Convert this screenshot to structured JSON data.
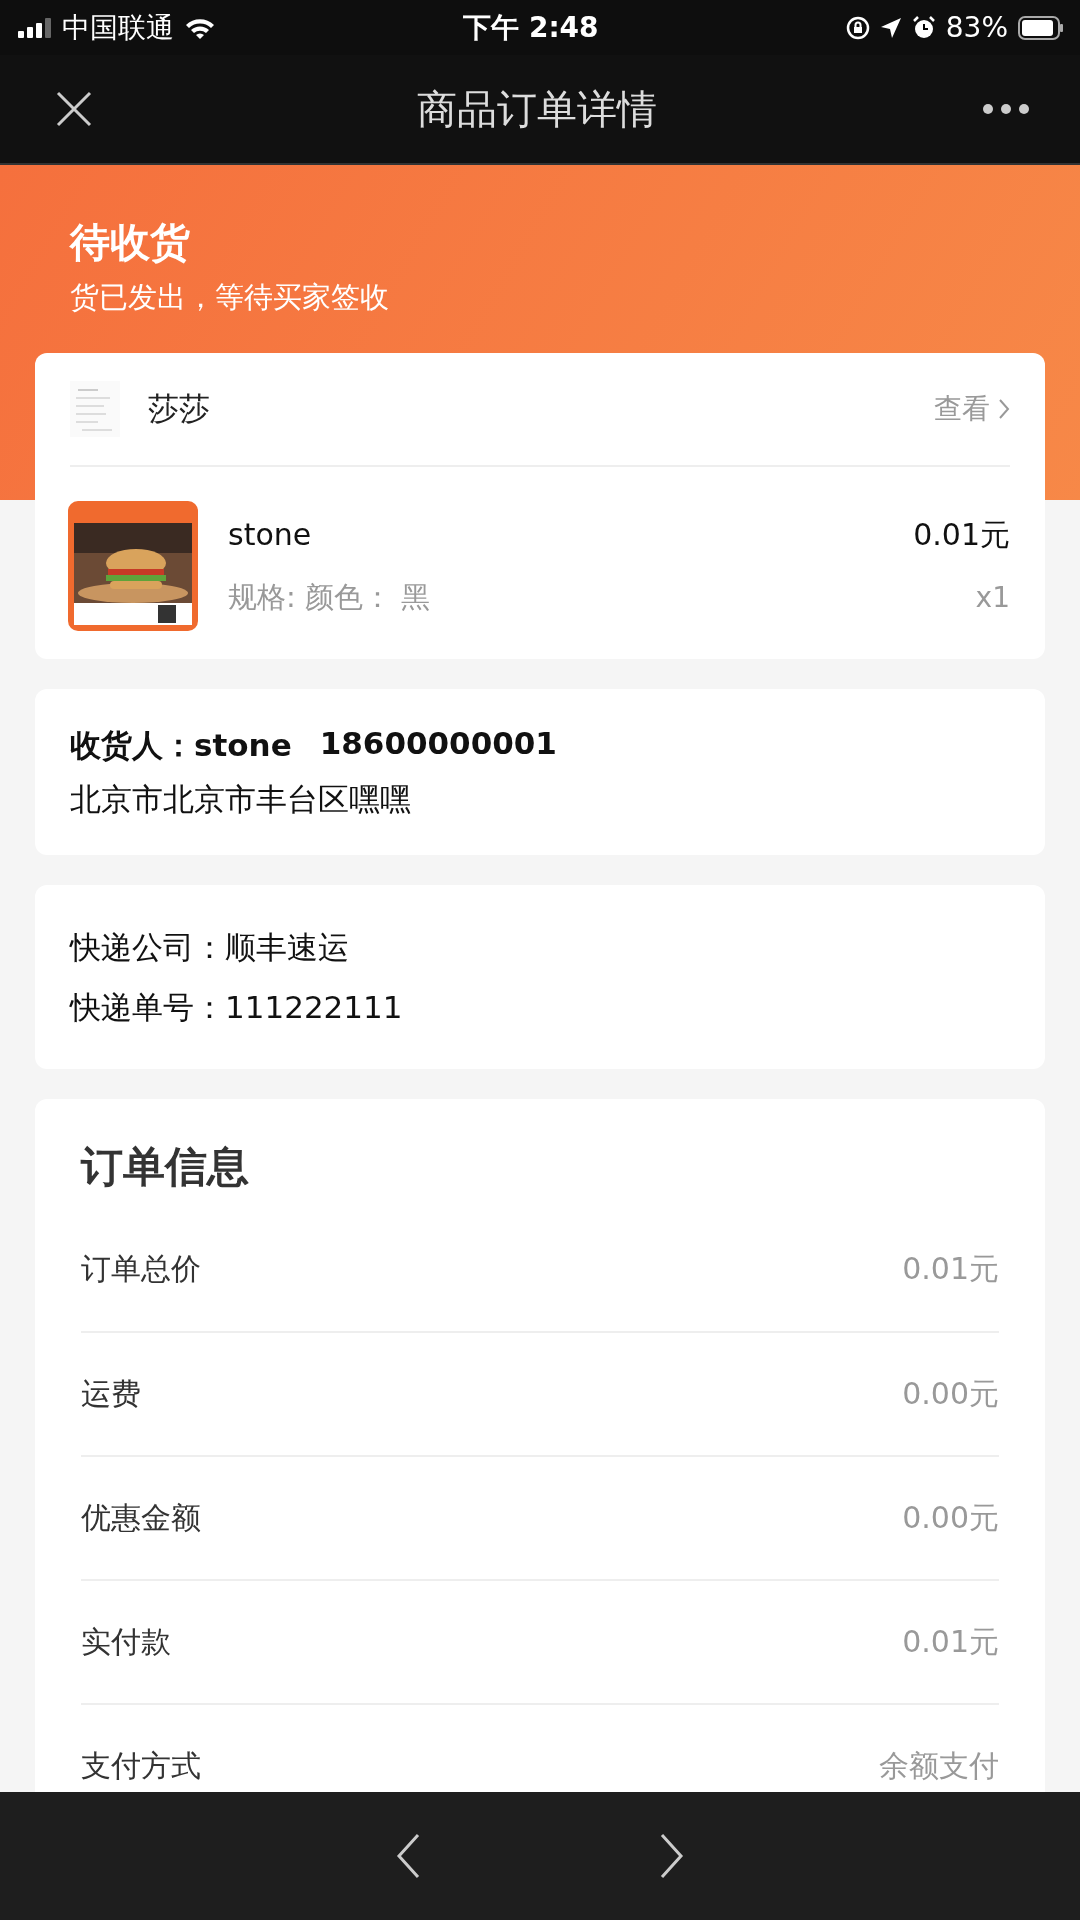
{
  "status_bar": {
    "carrier": "中国联通",
    "time": "下午 2:48",
    "battery": "83%"
  },
  "nav": {
    "title": "商品订单详情"
  },
  "order_status": {
    "title": "待收货",
    "subtitle": "货已发出，等待买家签收"
  },
  "shop": {
    "name": "莎莎",
    "link": "查看"
  },
  "product": {
    "name": "stone",
    "spec": "规格: 颜色： 黑",
    "price": "0.01元",
    "quantity": "x1"
  },
  "recipient": {
    "name": "收货人：stone",
    "phone": "18600000001",
    "address": "北京市北京市丰台区嘿嘿"
  },
  "shipping": {
    "company": "快递公司：顺丰速运",
    "tracking": "快递单号：111222111"
  },
  "order_info": {
    "title": "订单信息",
    "rows": [
      {
        "label": "订单总价",
        "value": "0.01元"
      },
      {
        "label": "运费",
        "value": "0.00元"
      },
      {
        "label": "优惠金额",
        "value": "0.00元"
      },
      {
        "label": "实付款",
        "value": "0.01元"
      },
      {
        "label": "支付方式",
        "value": "余额支付"
      }
    ]
  }
}
